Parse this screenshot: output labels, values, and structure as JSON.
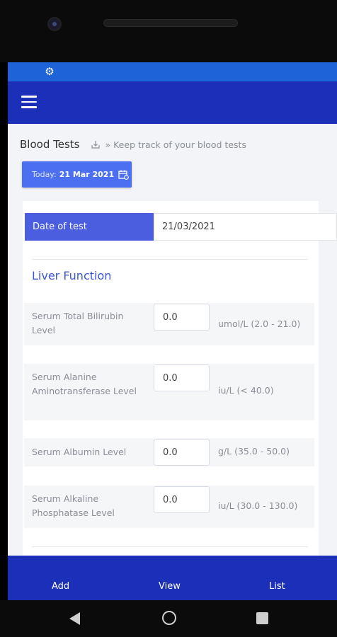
{
  "app": {
    "title": "Blood Tests",
    "subtitle": "» Keep track of your blood tests"
  },
  "date_button": {
    "today_label": "Today:",
    "today_value": "21 Mar 2021"
  },
  "date_of_test": {
    "label": "Date of test",
    "value": "21/03/2021"
  },
  "section": {
    "title": "Liver Function"
  },
  "tests": [
    {
      "label": "Serum Total Bilirubin Level",
      "value": "0.0",
      "unit": "umol/L (2.0 - 21.0)"
    },
    {
      "label": "Serum Alanine Aminotransferase Level",
      "value": "0.0",
      "unit": "iu/L (< 40.0)"
    },
    {
      "label": "Serum Albumin Level",
      "value": "0.0",
      "unit": "g/L (35.0 - 50.0)"
    },
    {
      "label": "Serum Alkaline Phosphatase Level",
      "value": "0.0",
      "unit": "iu/L (30.0 - 130.0)"
    }
  ],
  "bottom_nav": {
    "add": "Add",
    "view": "View",
    "list": "List"
  },
  "colors": {
    "app_bar": "#1b2fb8",
    "status_bar": "#1e64d8",
    "accent": "#4c6ef0",
    "section_title": "#3a55d6"
  },
  "icons": {
    "status": "gear-icon",
    "menu": "hamburger-menu-icon",
    "header": "download-icon",
    "date": "calendar-icon"
  }
}
